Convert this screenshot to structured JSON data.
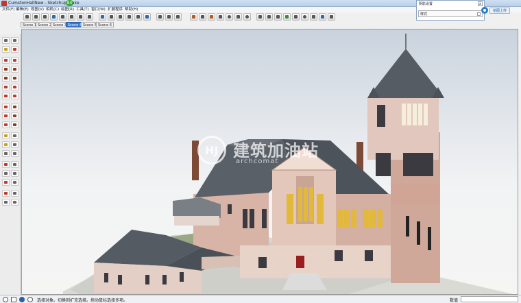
{
  "window": {
    "title": "CumstonHallNew - SketchUp Make",
    "badge": "84"
  },
  "menu": [
    {
      "label": "文件(F)"
    },
    {
      "label": "编辑(E)"
    },
    {
      "label": "视图(V)"
    },
    {
      "label": "相机(C)"
    },
    {
      "label": "绘图(R)"
    },
    {
      "label": "工具(T)"
    },
    {
      "label": "窗口(W)"
    },
    {
      "label": "扩展程序"
    },
    {
      "label": "帮助(H)"
    }
  ],
  "scenes": [
    {
      "label": "Scene 1",
      "active": false
    },
    {
      "label": "Scene 2",
      "active": false
    },
    {
      "label": "Scene 3",
      "active": false
    },
    {
      "label": "Scene 4",
      "active": true
    },
    {
      "label": "Scene 5",
      "active": false
    },
    {
      "label": "Scene 6",
      "active": false
    }
  ],
  "tray": {
    "title": "阴影设置",
    "style_label": "样式",
    "close": "x"
  },
  "upload": {
    "label": "拍图上传"
  },
  "watermark": {
    "main": "建筑加油站",
    "sub": "archcomat"
  },
  "status": {
    "hint": "选择对象。切换到扩充选择。拖动鼠标选择多项。",
    "measure_label": "数值",
    "measure_value": ""
  },
  "colors": {
    "accent": "#3b78c8",
    "brick": "#c9a595",
    "roof": "#555b63",
    "window_glow": "#e2b93a"
  }
}
